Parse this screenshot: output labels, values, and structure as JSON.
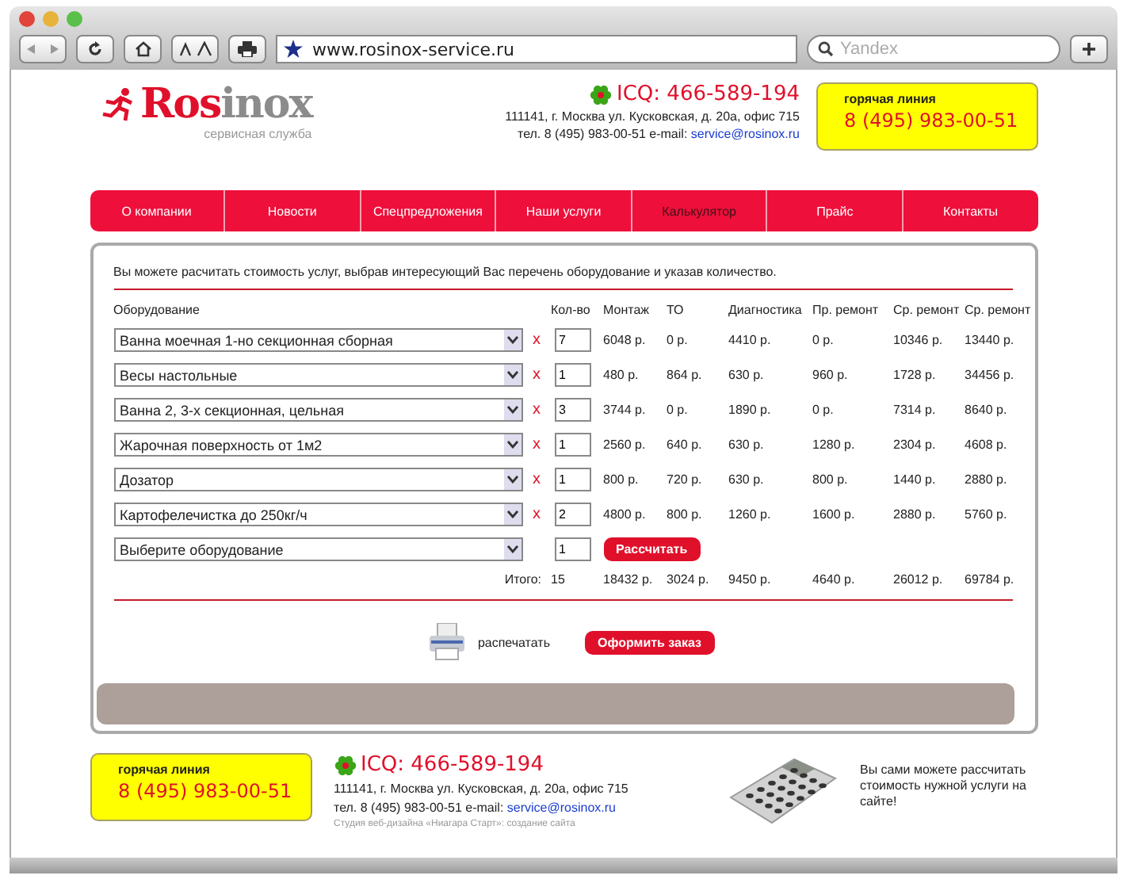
{
  "browser": {
    "url": "www.rosinox-service.ru",
    "search_placeholder": "Yandex"
  },
  "header": {
    "logo": {
      "first": "Ros",
      "second": "inox",
      "tagline": "сервисная служба"
    },
    "icq": "ICQ: 466-589-194",
    "address": "111141, г. Москва ул. Кусковская, д. 20а, офис 715",
    "phone": "тел. 8 (495) 983-00-51",
    "email_label": "e-mail:",
    "email": "service@rosinox.ru",
    "hotline": {
      "label": "горячая линия",
      "number": "8 (495) 983-00-51"
    }
  },
  "nav": [
    {
      "label": "О компании",
      "selected": false
    },
    {
      "label": "Новости",
      "selected": false
    },
    {
      "label": "Спецпредложения",
      "selected": false
    },
    {
      "label": "Наши услуги",
      "selected": false
    },
    {
      "label": "Калькулятор",
      "selected": true
    },
    {
      "label": "Прайс",
      "selected": false
    },
    {
      "label": "Контакты",
      "selected": false
    }
  ],
  "calculator": {
    "intro": "Вы можете расчитать стоимость услуг, выбрав интересующий Вас перечень оборудование и указав количество.",
    "columns": [
      "Оборудование",
      "Кол-во",
      "Монтаж",
      "ТО",
      "Диагностика",
      "Пр. ремонт",
      "Ср. ремонт",
      "Ср. ремонт"
    ],
    "rows": [
      {
        "equipment": "Ванна моечная 1-но секционная сборная",
        "remove": "x",
        "qty": "7",
        "values": [
          "6048 р.",
          "0 р.",
          "4410 р.",
          "0 р.",
          "10346 р.",
          "13440 р."
        ]
      },
      {
        "equipment": "Весы настольные",
        "remove": "x",
        "qty": "1",
        "values": [
          "480 р.",
          "864 р.",
          "630 р.",
          "960 р.",
          "1728 р.",
          "34456 р."
        ]
      },
      {
        "equipment": "Ванна 2, 3-х секционная, цельная",
        "remove": "x",
        "qty": "3",
        "values": [
          "3744 р.",
          "0 р.",
          "1890 р.",
          "0 р.",
          "7314 р.",
          "8640 р."
        ]
      },
      {
        "equipment": "Жарочная поверхность от 1м2",
        "remove": "x",
        "qty": "1",
        "values": [
          "2560 р.",
          "640 р.",
          "630 р.",
          "1280 р.",
          "2304 р.",
          "4608 р."
        ]
      },
      {
        "equipment": "Дозатор",
        "remove": "x",
        "qty": "1",
        "values": [
          "800 р.",
          "720 р.",
          "630 р.",
          "800 р.",
          "1440 р.",
          "2880 р."
        ]
      },
      {
        "equipment": "Картофелечистка до 250кг/ч",
        "remove": "x",
        "qty": "2",
        "values": [
          "4800 р.",
          "800 р.",
          "1260 р.",
          "1600 р.",
          "2880 р.",
          "5760 р."
        ]
      }
    ],
    "new_row": {
      "equipment": "Выберите оборудование",
      "qty": "1",
      "button": "Рассчитать"
    },
    "totals": {
      "label": "Итого:",
      "qty": "15",
      "values": [
        "18432 р.",
        "3024 р.",
        "9450 р.",
        "4640 р.",
        "26012 р.",
        "69784 р."
      ]
    },
    "print_label": "распечатать",
    "order_button": "Оформить заказ"
  },
  "footer": {
    "hotline": {
      "label": "горячая линия",
      "number": "8 (495) 983-00-51"
    },
    "icq": "ICQ: 466-589-194",
    "address": "111141, г. Москва ул. Кусковская, д. 20а, офис 715",
    "phone": "тел. 8 (495) 983-00-51",
    "email_label": "e-mail:",
    "email": "service@rosinox.ru",
    "credit": "Студия веб-дизайна «Ниагара Старт»: создание сайта",
    "promo": "Вы сами можете рассчитать стоимость нужной услуги на сайте!"
  }
}
